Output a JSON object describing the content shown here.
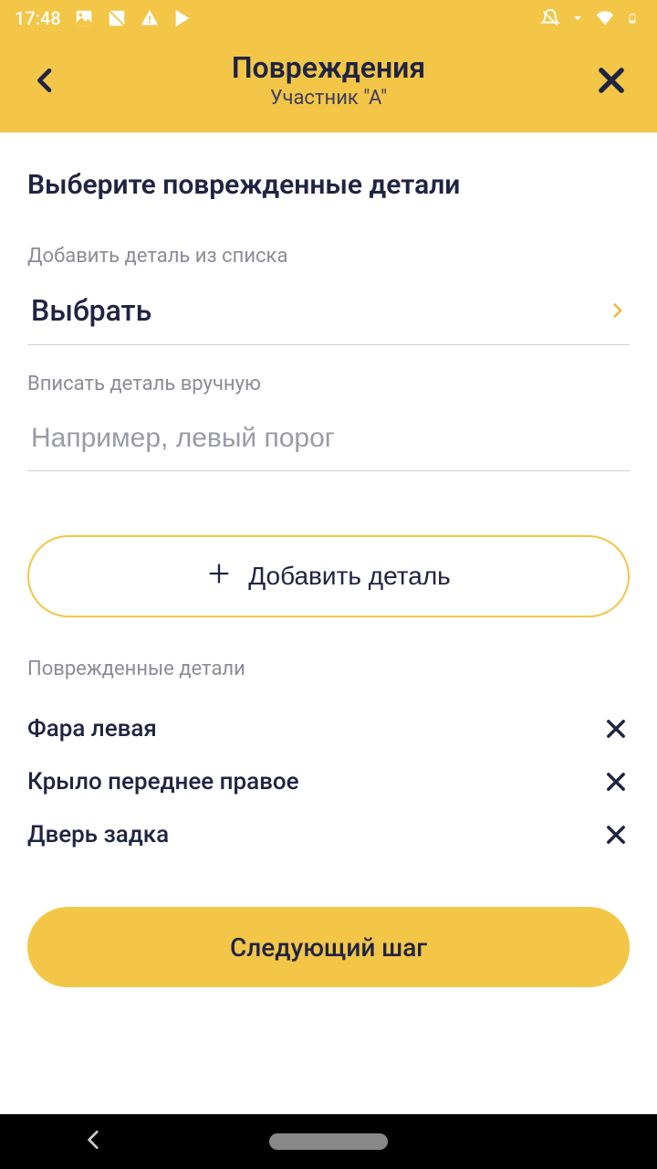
{
  "status": {
    "time": "17:48"
  },
  "header": {
    "title": "Повреждения",
    "subtitle": "Участник \"А\""
  },
  "main": {
    "heading": "Выберите поврежденные детали",
    "select_label": "Добавить деталь из списка",
    "select_value": "Выбрать",
    "manual_label": "Вписать деталь вручную",
    "manual_placeholder": "Например, левый порог",
    "add_button": "Добавить деталь",
    "damaged_label": "Поврежденные детали",
    "damaged_items": [
      "Фара левая",
      "Крыло переднее правое",
      "Дверь задка"
    ],
    "next_button": "Следующий шаг"
  }
}
